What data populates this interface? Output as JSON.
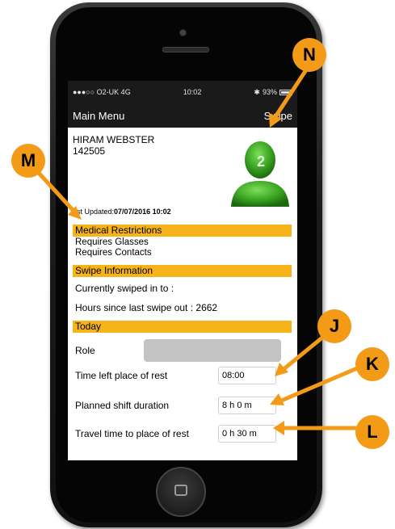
{
  "status_bar": {
    "carrier": "●●●○○ O2-UK  4G",
    "time": "10:02",
    "battery": "93%"
  },
  "nav_bar": {
    "back_label": "Main Menu",
    "action_label": "Swipe"
  },
  "person": {
    "name": "HIRAM WEBSTER",
    "id": "142505",
    "avatar_badge": "2",
    "last_updated_prefix": "ast Updated:",
    "last_updated_value": "07/07/2016 10:02"
  },
  "medical": {
    "header": "Medical Restrictions",
    "items": [
      "Requires Glasses",
      "Requires Contacts"
    ]
  },
  "swipe": {
    "header": "Swipe Information",
    "currently": "Currently swiped in to :",
    "hours_since": "Hours since last swipe out : 2662"
  },
  "today": {
    "header": "Today",
    "role_label": "Role",
    "time_left_label": "Time left place of rest",
    "time_left_value": "08:00",
    "shift_label": "Planned shift duration",
    "shift_value": "8 h  0 m",
    "travel_label": "Travel time to place of rest",
    "travel_value": "0 h 30 m"
  },
  "callouts": {
    "N": "N",
    "M": "M",
    "J": "J",
    "K": "K",
    "L": "L"
  },
  "colors": {
    "accent": "#f6b41a",
    "callout": "#f39a17",
    "avatar_green": "#3aa321"
  }
}
